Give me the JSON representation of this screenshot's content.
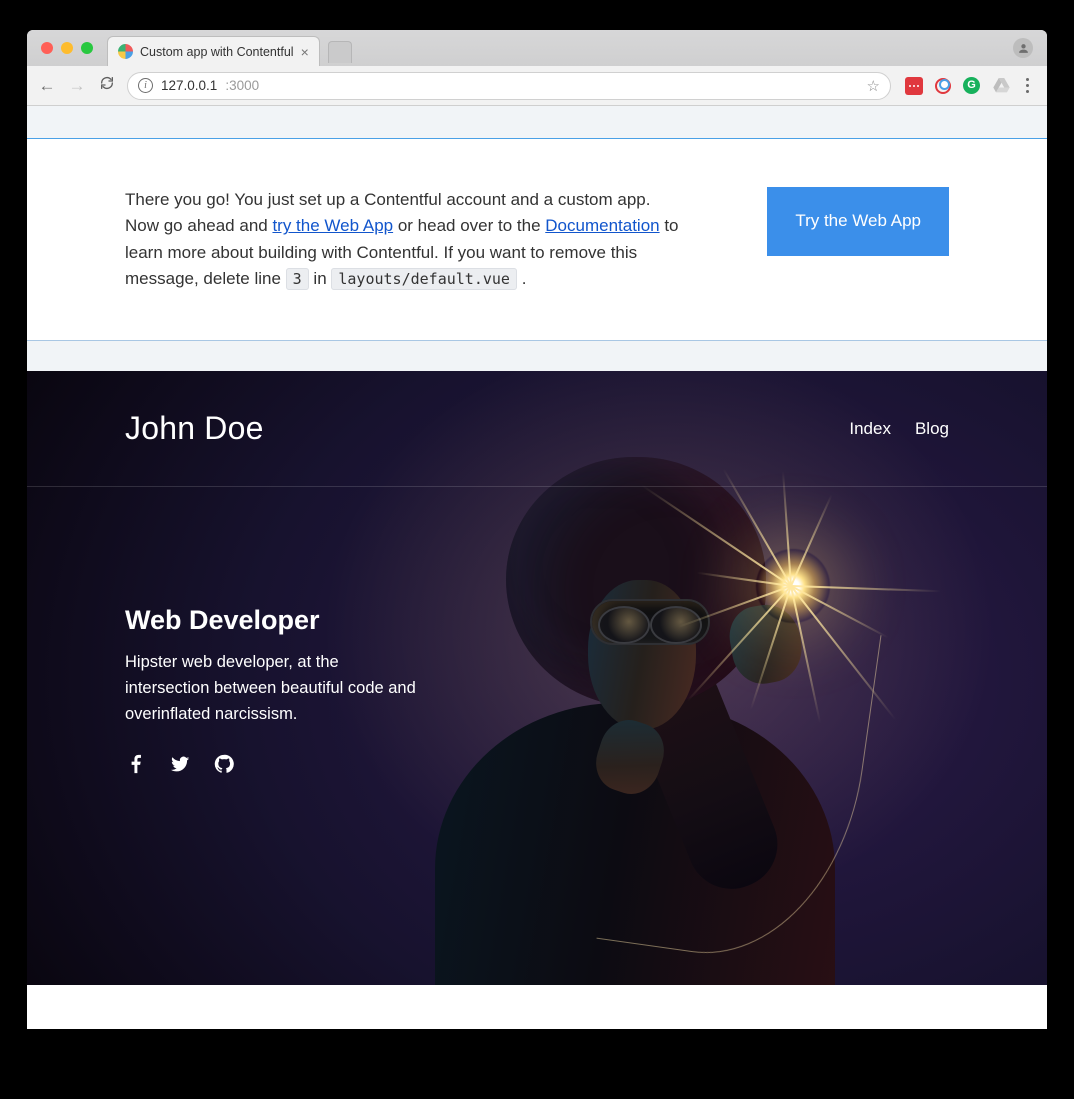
{
  "browser": {
    "tab_title": "Custom app with Contentful",
    "url_host": "127.0.0.1",
    "url_port": ":3000"
  },
  "notice": {
    "text_a": "There you go! You just set up a Contentful account and a custom app. Now go ahead and ",
    "link_try": "try the Web App",
    "text_b": " or head over to the ",
    "link_docs": "Documentation",
    "text_c": " to learn more about building with Contentful. If you want to remove this message, delete line ",
    "code_line": "3",
    "text_d": " in ",
    "code_path": "layouts/default.vue",
    "text_e": " .",
    "cta": "Try the Web App"
  },
  "hero": {
    "brand": "John Doe",
    "nav": {
      "index": "Index",
      "blog": "Blog"
    },
    "role": "Web Developer",
    "bio": "Hipster web developer, at the intersection between beautiful code and overinflated narcissism."
  }
}
